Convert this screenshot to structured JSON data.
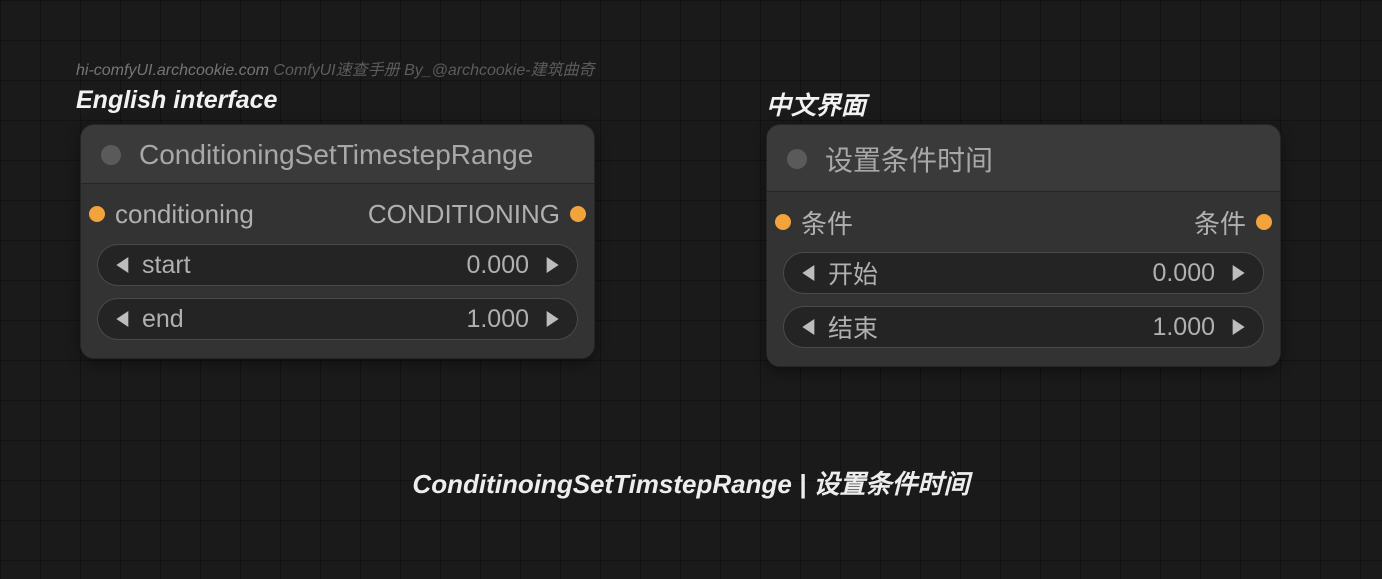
{
  "watermark": {
    "url": "hi-comfyUI.archcookie.com",
    "text": " ComfyUI速查手册 By_@archcookie-建筑曲奇"
  },
  "labels": {
    "english": "English interface",
    "chinese": "中文界面"
  },
  "node_en": {
    "title": "ConditioningSetTimestepRange",
    "input_label": "conditioning",
    "output_label": "CONDITIONING",
    "params": [
      {
        "name": "start",
        "value": "0.000"
      },
      {
        "name": "end",
        "value": "1.000"
      }
    ]
  },
  "node_cn": {
    "title": "设置条件时间",
    "input_label": "条件",
    "output_label": "条件",
    "params": [
      {
        "name": "开始",
        "value": "0.000"
      },
      {
        "name": "结束",
        "value": "1.000"
      }
    ]
  },
  "footer": "ConditinoingSetTimstepRange | 设置条件时间",
  "colors": {
    "conditioning_port": "#f2a33c",
    "node_bg": "#3a3a3a",
    "body_bg": "#333333",
    "param_bg": "#242424"
  }
}
